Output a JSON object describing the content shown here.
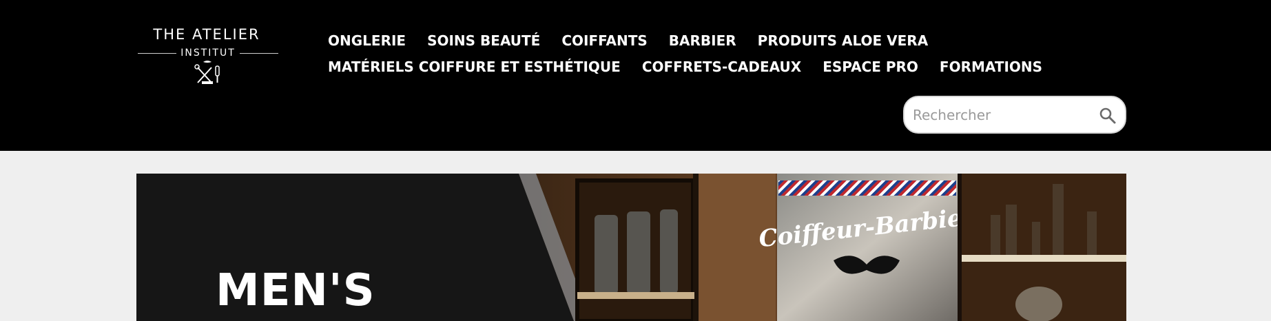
{
  "brand": {
    "name_line1": "THE ATELIER",
    "name_line2": "INSTITUT"
  },
  "nav": {
    "row1": [
      "ONGLERIE",
      "SOINS BEAUTÉ",
      "COIFFANTS",
      "BARBIER",
      "PRODUITS ALOE VERA"
    ],
    "row2": [
      "MATÉRIELS COIFFURE ET ESTHÉTIQUE",
      "COFFRETS-CADEAUX",
      "ESPACE PRO",
      "FORMATIONS"
    ]
  },
  "search": {
    "placeholder": "Rechercher",
    "icon": "search-icon"
  },
  "banner": {
    "heading": "MEN'S",
    "shop_sign": "Coiffeur-Barbier"
  },
  "colors": {
    "header_bg": "#000000",
    "page_bg": "#efefef",
    "banner_dark": "#161616",
    "nav_text": "#ffffff"
  }
}
